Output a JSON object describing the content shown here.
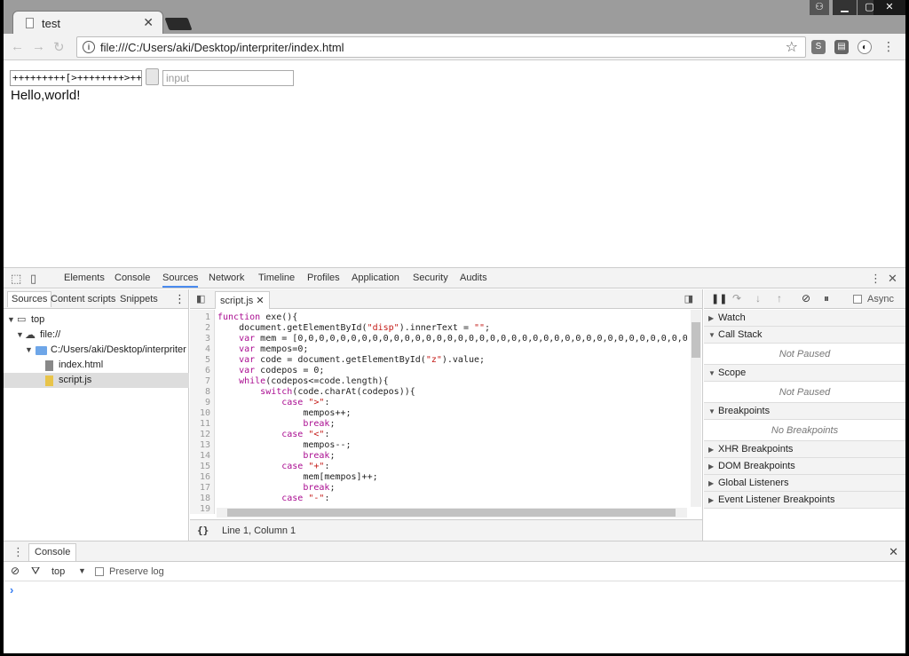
{
  "browser": {
    "tab_title": "test",
    "url": "file:///C:/Users/aki/Desktop/interpriter/index.html"
  },
  "page": {
    "code_value": "+++++++++[>++++++++>++",
    "input_placeholder": "input",
    "output_text": "Hello,world!"
  },
  "devtools": {
    "tabs": [
      "Elements",
      "Console",
      "Sources",
      "Network",
      "Timeline",
      "Profiles",
      "Application",
      "Security",
      "Audits"
    ],
    "active_tab": "Sources",
    "navigator_tabs": [
      "Sources",
      "Content scripts",
      "Snippets"
    ],
    "tree": {
      "top": "top",
      "file": "file://",
      "folder": "C:/Users/aki/Desktop/interpriter",
      "file1": "index.html",
      "file2": "script.js"
    },
    "editor_tab": "script.js",
    "line_numbers": [
      "1",
      "2",
      "3",
      "4",
      "5",
      "6",
      "7",
      "8",
      "9",
      "10",
      "11",
      "12",
      "13",
      "14",
      "15",
      "16",
      "17",
      "18",
      "19"
    ],
    "cursor_status": "Line 1, Column 1",
    "async_label": "Async",
    "sections": {
      "watch": "Watch",
      "call_stack": "Call Stack",
      "not_paused_1": "Not Paused",
      "scope": "Scope",
      "not_paused_2": "Not Paused",
      "breakpoints": "Breakpoints",
      "no_breakpoints": "No Breakpoints",
      "xhr": "XHR Breakpoints",
      "dom": "DOM Breakpoints",
      "global": "Global Listeners",
      "event": "Event Listener Breakpoints"
    },
    "drawer": {
      "tab": "Console",
      "context": "top",
      "preserve_log": "Preserve log",
      "prompt": "›"
    }
  }
}
